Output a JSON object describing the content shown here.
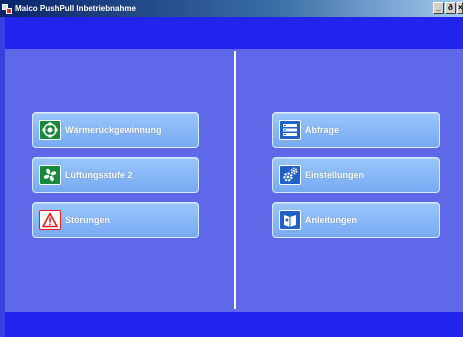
{
  "window": {
    "title": "Maico PushPull Inbetriebnahme",
    "minimize": "_",
    "maximize": "ð",
    "close": "×"
  },
  "left_menu": [
    {
      "label": "Wärmerückgewinnung",
      "icon": "heat-recovery-icon"
    },
    {
      "label": "Lüftungsstufe 2",
      "icon": "fan-icon"
    },
    {
      "label": "Störungen",
      "icon": "warning-icon"
    }
  ],
  "right_menu": [
    {
      "label": "Abfrage",
      "icon": "list-icon"
    },
    {
      "label": "Einstellungen",
      "icon": "gears-icon"
    },
    {
      "label": "Anleitungen",
      "icon": "manual-icon"
    }
  ],
  "colors": {
    "titlebar": "#0a246a",
    "band": "#2323ee",
    "panel": "#6068ea",
    "button": "#8ab8f8",
    "icon_green": "#168a3a",
    "icon_blue": "#1e62c8",
    "alert_red": "#e02020"
  }
}
